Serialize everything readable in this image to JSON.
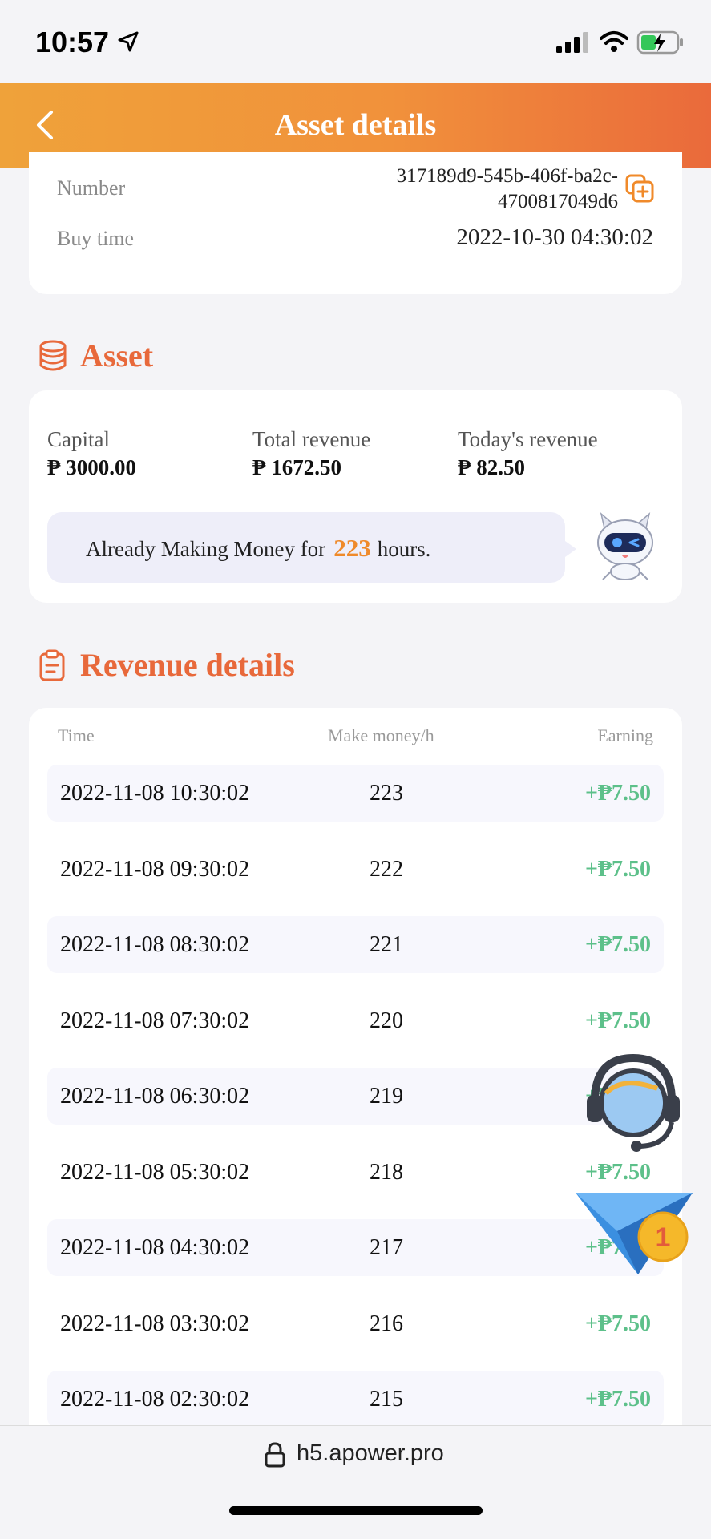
{
  "status": {
    "time": "10:57"
  },
  "header": {
    "title": "Asset details"
  },
  "info": {
    "number_label": "Number",
    "number_line1": "317189d9-545b-406f-ba2c-",
    "number_line2": "4700817049d6",
    "buy_time_label": "Buy time",
    "buy_time_value": "2022-10-30 04:30:02"
  },
  "asset": {
    "section_title": "Asset",
    "capital_label": "Capital",
    "capital_value": "₱ 3000.00",
    "total_label": "Total revenue",
    "total_value": "₱ 1672.50",
    "today_label": "Today's revenue",
    "today_value": "₱ 82.50",
    "making_prefix": "Already Making Money for",
    "making_hours": "223",
    "making_suffix": "hours."
  },
  "revenue": {
    "section_title": "Revenue details",
    "col_time": "Time",
    "col_rate": "Make money/h",
    "col_earning": "Earning",
    "rows": [
      {
        "time": "2022-11-08 10:30:02",
        "rate": "223",
        "earning": "+₱7.50"
      },
      {
        "time": "2022-11-08 09:30:02",
        "rate": "222",
        "earning": "+₱7.50"
      },
      {
        "time": "2022-11-08 08:30:02",
        "rate": "221",
        "earning": "+₱7.50"
      },
      {
        "time": "2022-11-08 07:30:02",
        "rate": "220",
        "earning": "+₱7.50"
      },
      {
        "time": "2022-11-08 06:30:02",
        "rate": "219",
        "earning": "+₱7.50"
      },
      {
        "time": "2022-11-08 05:30:02",
        "rate": "218",
        "earning": "+₱7.50"
      },
      {
        "time": "2022-11-08 04:30:02",
        "rate": "217",
        "earning": "+₱7.50"
      },
      {
        "time": "2022-11-08 03:30:02",
        "rate": "216",
        "earning": "+₱7.50"
      },
      {
        "time": "2022-11-08 02:30:02",
        "rate": "215",
        "earning": "+₱7.50"
      }
    ]
  },
  "telegram_badge": "1",
  "browser": {
    "url": "h5.apower.pro"
  },
  "colors": {
    "accent": "#e8693b",
    "header_start": "#efa23a",
    "header_end": "#ea6a3b",
    "earning": "#5dc08a"
  }
}
